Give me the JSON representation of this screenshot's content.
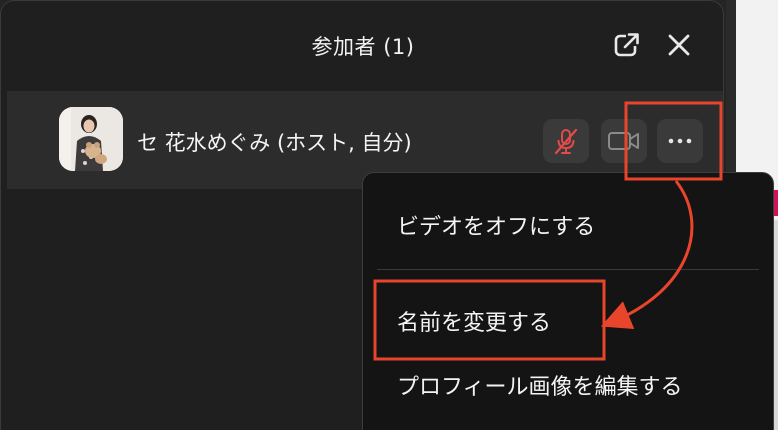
{
  "panel": {
    "title": "参加者 (1)",
    "popout_icon": "popout-icon",
    "close_icon": "close-icon"
  },
  "participant": {
    "name": "セ 花水めぐみ (ホスト, 自分)",
    "mic_state": "muted",
    "mic_icon": "mic-muted-icon",
    "video_icon": "video-camera-icon",
    "more_icon": "more-horizontal-icon"
  },
  "menu": {
    "items": [
      {
        "label": "ビデオをオフにする"
      },
      {
        "label": "名前を変更する"
      },
      {
        "label": "プロフィール画像を編集する"
      }
    ]
  },
  "colors": {
    "panel_bg": "#1f1f1f",
    "row_bg": "#2c2c2c",
    "button_bg": "#3a3a3a",
    "muted_red": "#e34a4a",
    "annotation_red": "#e8452c",
    "menu_bg": "#141414"
  }
}
